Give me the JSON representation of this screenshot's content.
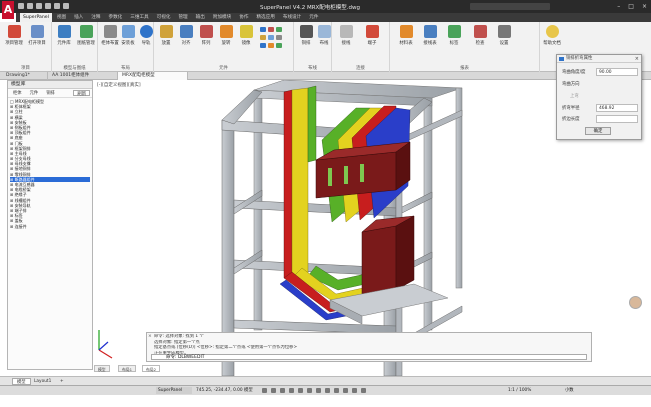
{
  "app": {
    "logo_letter": "A",
    "title": "SuperPanel V4.2    MRX配电柜模型.dwg"
  },
  "menu_tabs": [
    "SuperPanel",
    "视图",
    "插入",
    "注释",
    "参数化",
    "三维工具",
    "可视化",
    "管理",
    "输出",
    "附加模块",
    "协作",
    "精选应用",
    "布线设计",
    "元件"
  ],
  "ribbon": {
    "groups": [
      {
        "name": "项目",
        "buttons": [
          "项目管理",
          "打开项目"
        ]
      },
      {
        "name": "模型与图纸",
        "buttons": [
          "元件库",
          "图纸管理"
        ]
      },
      {
        "name": "布局",
        "buttons": [
          "柜体布置",
          "安装板",
          "导轨",
          "线槽"
        ]
      },
      {
        "name": "元件",
        "buttons": [
          "放置",
          "对齐",
          "阵列",
          "旋转",
          "镜像",
          "复制"
        ]
      },
      {
        "name": "布线",
        "buttons": [
          "铜排",
          "布线"
        ]
      },
      {
        "name": "连接",
        "buttons": [
          "接线",
          "端子"
        ]
      },
      {
        "name": "报表",
        "buttons": [
          "材料表",
          "接线表",
          "标签"
        ]
      },
      {
        "name": "工具",
        "buttons": [
          "检查",
          "设置"
        ]
      },
      {
        "name": "帮助",
        "buttons": [
          "帮助文档"
        ]
      }
    ]
  },
  "doc_tabs": [
    "Drawing1*",
    "AA 1001柜体组件",
    "MRX配电柜模型"
  ],
  "left_panel": {
    "title": "模型库",
    "tabs": [
      "柜体",
      "元件",
      "铜排"
    ],
    "button": "刷新",
    "tree": [
      "□ MRX配电柜模型",
      "  ⊞ 柜体框架",
      "  ⊞ 立柱",
      "  ⊞ 横梁",
      "  ⊞ 安装板",
      "  ⊞ 侧板组件",
      "  ⊞ 顶板组件",
      "  ⊞ 底座",
      "  ⊞ 门板",
      "  ⊞ 框架铜排",
      "  ⊞ 主母线",
      "  ⊞ 分支母线",
      "  ⊞ 母线支撑",
      "  ⊞ 接地铜排",
      "  ⊞ 零线铜排",
      "  ⊞ 断路器组件",
      "  ⊞ 电流互感器",
      "  ⊞ 电缆桥架",
      "  ⊞ 绝缘子",
      "  ⊞ 线槽组件",
      "  ⊞ 安装导轨",
      "  ⊞ 端子排",
      "  ⊞ 标签",
      "  ⊞ 盖板",
      "  ⊞ 连接件"
    ],
    "selected_index": 15
  },
  "viewport": {
    "label": "[-][自定义视图][真实]"
  },
  "dialog": {
    "title": "铜排折弯属性",
    "rows": [
      {
        "label": "弯曲角度/度",
        "value": "90.00",
        "dim": false
      },
      {
        "label": "弯曲方向",
        "value": "",
        "dim": false
      },
      {
        "label": "上弯",
        "value": "",
        "dim": true
      },
      {
        "label": "折弯半径",
        "value": "468.92",
        "dim": false
      },
      {
        "label": "折边长度",
        "value": "",
        "dim": false
      }
    ],
    "ok_label": "确定"
  },
  "command": {
    "lines": [
      "命令: 选择对象: 找到 1 个",
      "选择对象: 指定第一个点",
      "指定基点或 [位移(D)] <位移>: 指定第二个点或 <使用第一个点作为位移>",
      "正在重生成模型。"
    ],
    "input": "命令: DLBWEEDIT"
  },
  "layout_tabs": [
    "模型",
    "布局1",
    "布局2"
  ],
  "model_tabs": [
    "模型",
    "Layout1",
    "+"
  ],
  "status": {
    "left": "SuperPanel",
    "coords": "745.25, -234.47, 0.00   模型",
    "scale": "1:1 / 100%",
    "mode": "小数"
  },
  "colors": {
    "accent": "#c8102e",
    "busbar_yellow": "#e3d21f",
    "busbar_green": "#58b028",
    "busbar_red": "#c71e1e",
    "busbar_blue": "#2a3ec9",
    "frame_gray": "#b7bcc2",
    "cabinet_maroon": "#7a1a1a"
  }
}
